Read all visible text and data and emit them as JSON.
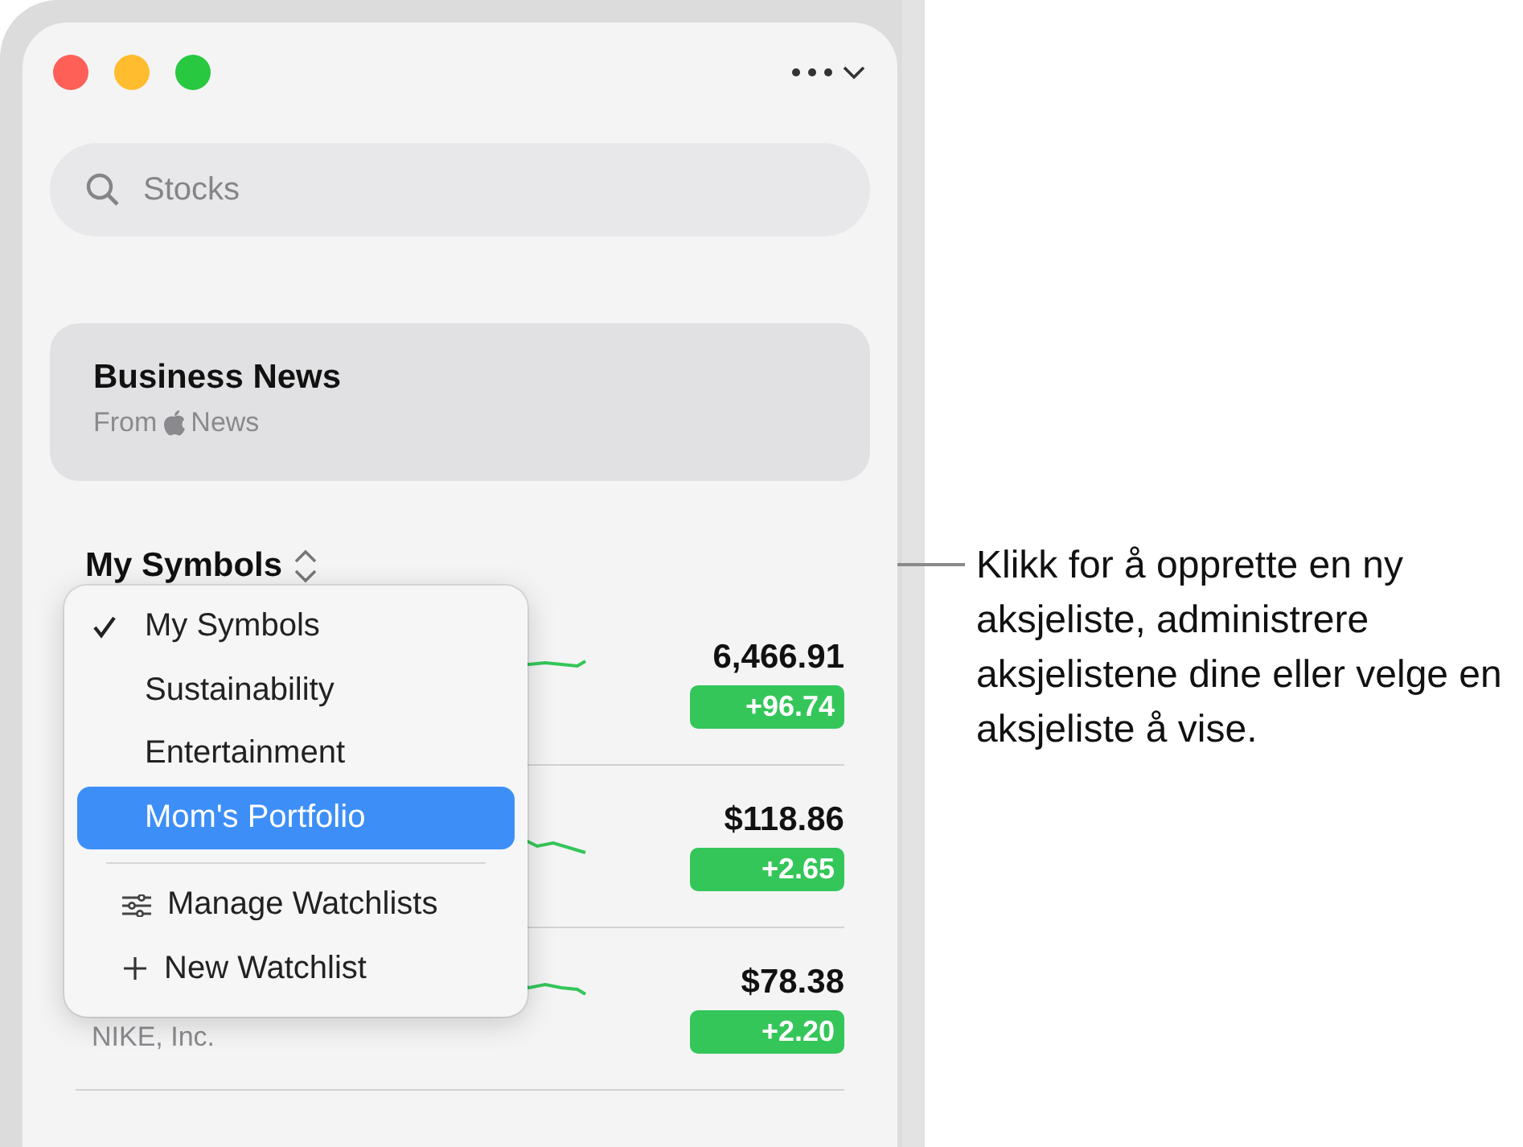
{
  "search": {
    "placeholder": "Stocks"
  },
  "news_card": {
    "title": "Business News",
    "source_prefix": "From",
    "source_name": "News"
  },
  "watchlist_header": {
    "title": "My Symbols"
  },
  "stocks": [
    {
      "price": "6,466.91",
      "change": "+96.74"
    },
    {
      "price": "$118.86",
      "change": "+2.65"
    },
    {
      "company": "NIKE, Inc.",
      "price": "$78.38",
      "change": "+2.20"
    }
  ],
  "menu": {
    "items": [
      {
        "kind": "option",
        "label": "My Symbols",
        "checked": true,
        "selected": false
      },
      {
        "kind": "option",
        "label": "Sustainability",
        "checked": false,
        "selected": false
      },
      {
        "kind": "option",
        "label": "Entertainment",
        "checked": false,
        "selected": false
      },
      {
        "kind": "option",
        "label": "Mom's Portfolio",
        "checked": false,
        "selected": true
      },
      {
        "kind": "manage",
        "label": "Manage Watchlists",
        "selected": false
      },
      {
        "kind": "new",
        "label": "New Watchlist",
        "selected": false
      }
    ]
  },
  "callout": "Klikk for å opprette en ny aksjeliste, administrere aksjelistene dine eller velge en aksjeliste å vise."
}
